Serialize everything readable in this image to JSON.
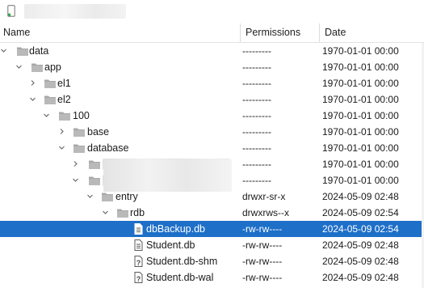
{
  "columns": {
    "name": "Name",
    "permissions": "Permissions",
    "date": "Date"
  },
  "rows": [
    {
      "name": "data",
      "perm": "---------",
      "date": "1970-01-01 00:00",
      "icon": "folder-icon",
      "expanded": true
    },
    {
      "name": "app",
      "perm": "---------",
      "date": "1970-01-01 00:00",
      "icon": "folder-icon",
      "expanded": true
    },
    {
      "name": "el1",
      "perm": "---------",
      "date": "1970-01-01 00:00",
      "icon": "folder-icon",
      "expanded": false
    },
    {
      "name": "el2",
      "perm": "---------",
      "date": "1970-01-01 00:00",
      "icon": "folder-icon",
      "expanded": true
    },
    {
      "name": "100",
      "perm": "---------",
      "date": "1970-01-01 00:00",
      "icon": "folder-icon",
      "expanded": true
    },
    {
      "name": "base",
      "perm": "---------",
      "date": "1970-01-01 00:00",
      "icon": "folder-icon",
      "expanded": false
    },
    {
      "name": "database",
      "perm": "---------",
      "date": "1970-01-01 00:00",
      "icon": "folder-icon",
      "expanded": true
    },
    {
      "name": "",
      "perm": "---------",
      "date": "1970-01-01 00:00",
      "icon": "folder-icon",
      "expanded": false
    },
    {
      "name": "",
      "perm": "---------",
      "date": "1970-01-01 00:00",
      "icon": "folder-icon",
      "expanded": true
    },
    {
      "name": "entry",
      "perm": "drwxr-sr-x",
      "date": "2024-05-09 02:48",
      "icon": "folder-icon",
      "expanded": true
    },
    {
      "name": "rdb",
      "perm": "drwxrws--x",
      "date": "2024-05-09 02:54",
      "icon": "folder-icon",
      "expanded": true
    },
    {
      "name": "dbBackup.db",
      "perm": "-rw-rw----",
      "date": "2024-05-09 02:54",
      "icon": "file-icon",
      "selected": true
    },
    {
      "name": "Student.db",
      "perm": "-rw-rw----",
      "date": "2024-05-09 02:48",
      "icon": "file-icon"
    },
    {
      "name": "Student.db-shm",
      "perm": "-rw-rw----",
      "date": "2024-05-09 02:48",
      "icon": "unknown-file-icon"
    },
    {
      "name": "Student.db-wal",
      "perm": "-rw-rw----",
      "date": "2024-05-09 02:48",
      "icon": "unknown-file-icon"
    }
  ],
  "colors": {
    "selected": "#1e6fc8",
    "folder": "#a8a8a8",
    "device": "#2fa84f"
  }
}
